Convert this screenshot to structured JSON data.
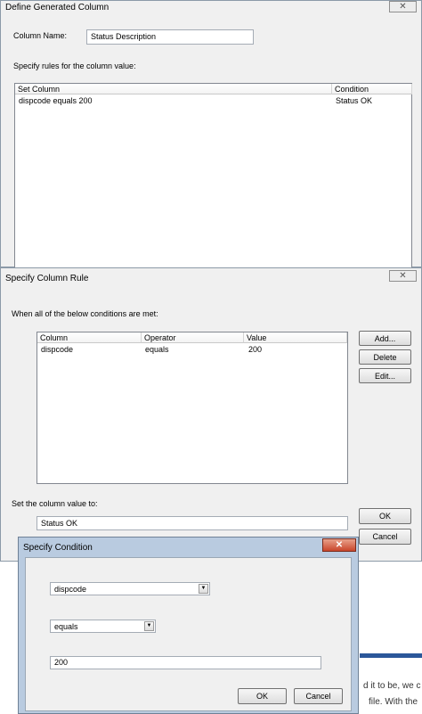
{
  "background": {
    "fragment_1": "d it to be, we c",
    "fragment_2": "file. With the"
  },
  "define_dialog": {
    "title": "Define Generated Column",
    "column_name_label": "Column Name:",
    "column_name_value": "Status Description",
    "rules_label": "Specify rules for the column value:",
    "columns": [
      "Set Column",
      "Condition"
    ],
    "rows": [
      {
        "set_column": "dispcode equals 200",
        "condition": "Status OK"
      }
    ]
  },
  "rule_dialog": {
    "title": "Specify Column Rule",
    "conditions_label": "When all of the below conditions are met:",
    "columns": [
      "Column",
      "Operator",
      "Value"
    ],
    "rows": [
      {
        "column": "dispcode",
        "operator": "equals",
        "value": "200"
      }
    ],
    "add_label": "Add...",
    "delete_label": "Delete",
    "edit_label": "Edit...",
    "set_value_label": "Set the column value to:",
    "set_value": "Status OK",
    "ok_label": "OK",
    "cancel_label": "Cancel"
  },
  "condition_dialog": {
    "title": "Specify Condition",
    "column_select": "dispcode",
    "operator_select": "equals",
    "value": "200",
    "ok_label": "OK",
    "cancel_label": "Cancel",
    "close_glyph": "✕"
  }
}
